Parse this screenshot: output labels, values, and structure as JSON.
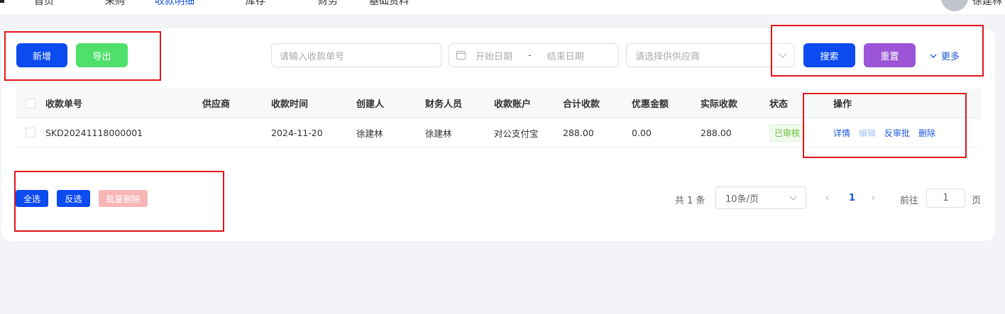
{
  "topbar": {
    "nav": [
      "首页",
      "采购",
      "收款明细",
      "库存",
      "财务",
      "基础资料"
    ],
    "user_name": "徐建林"
  },
  "toolbar": {
    "add_label": "新增",
    "export_label": "导出",
    "search_label": "搜索",
    "reset_label": "重置",
    "more_label": "更多"
  },
  "filters": {
    "order_placeholder": "请输入收款单号",
    "start_date_placeholder": "开始日期",
    "date_separator": "-",
    "end_date_placeholder": "结束日期",
    "supplier_placeholder": "请选择供供应商"
  },
  "table": {
    "headers": [
      "收款单号",
      "供应商",
      "收款时间",
      "创建人",
      "财务人员",
      "收款账户",
      "合计收款",
      "优惠金额",
      "实际收款",
      "状态",
      "操作"
    ],
    "rows": [
      {
        "order_no": "SKD20241118000001",
        "supplier": "",
        "time": "2024-11-20",
        "creator": "徐建林",
        "finance": "徐建林",
        "account": "对公支付宝",
        "total": "288.00",
        "discount": "0.00",
        "actual": "288.00",
        "status": "已审核",
        "actions": [
          "详情",
          "编辑",
          "反审批",
          "删除"
        ]
      }
    ]
  },
  "bulk": {
    "select_all": "全选",
    "invert": "反选",
    "batch_delete": "批量删除"
  },
  "pagination": {
    "total_text": "共 1 条",
    "page_size": "10条/页",
    "prev": "‹",
    "current_page": "1",
    "next": "›",
    "goto_label": "前往",
    "goto_value": "1",
    "goto_unit": "页"
  },
  "colors": {
    "primary": "#0b4bf0",
    "export_green": "#4ee06b",
    "reset_purple": "#9b55d6",
    "annotation_red": "#e0161b",
    "status_green": "#67c23a"
  }
}
